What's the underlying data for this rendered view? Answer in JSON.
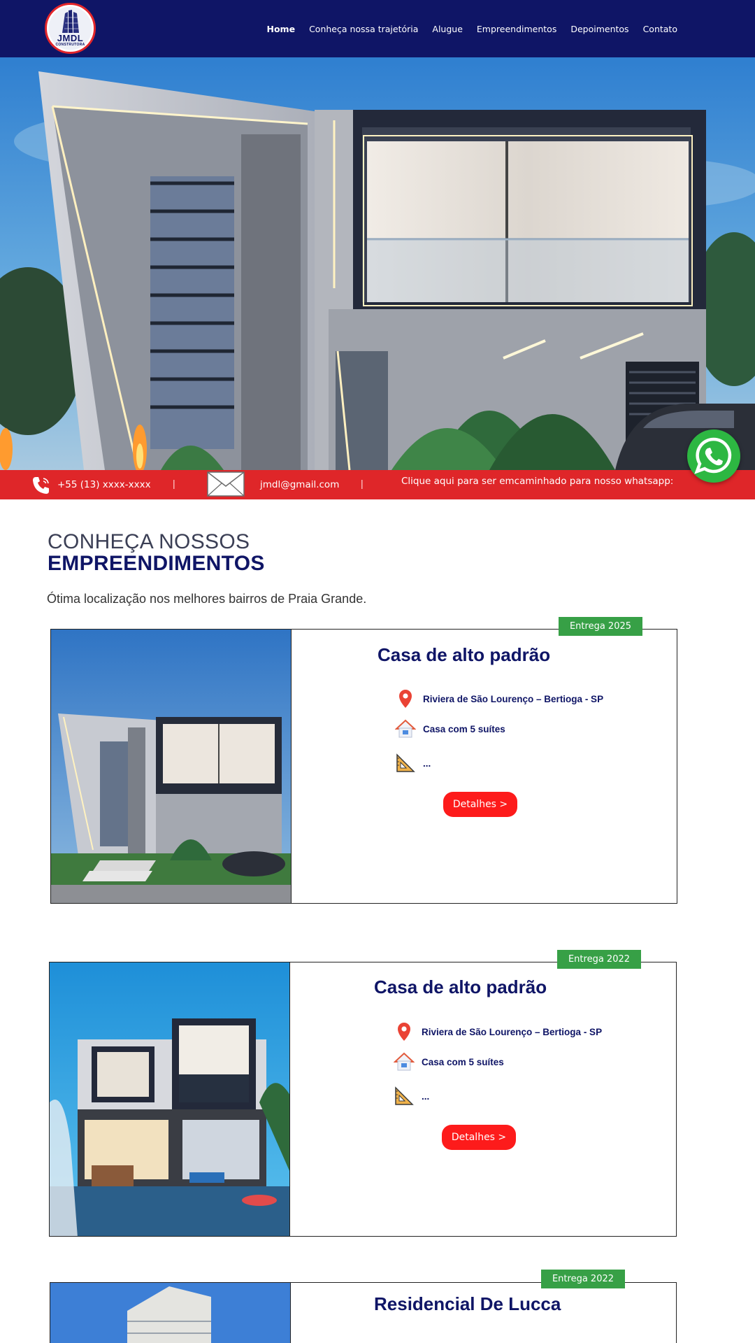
{
  "header": {
    "logo": {
      "name": "JMDL",
      "tagline": "CONSTRUTORA"
    },
    "nav": [
      {
        "label": "Home",
        "active": true
      },
      {
        "label": "Conheça nossa trajetória",
        "active": false
      },
      {
        "label": "Alugue",
        "active": false
      },
      {
        "label": "Empreendimentos",
        "active": false
      },
      {
        "label": "Depoimentos",
        "active": false
      },
      {
        "label": "Contato",
        "active": false
      }
    ],
    "bg_color": "#0f1566"
  },
  "contact_bar": {
    "phone": "+55 (13) xxxx-xxxx",
    "separator": "|",
    "email": "jmdl@gmail.com",
    "whatsapp_text": "Clique aqui para ser emcaminhado para nosso whatsapp:",
    "bg_color": "#df2629",
    "icons": [
      "phone-icon",
      "mail-icon",
      "whatsapp-icon"
    ]
  },
  "section": {
    "title_line1": "CONHEÇA NOSSOS",
    "title_line2": "EMPREENDIMENTOS",
    "subtitle": "Ótima localização nos melhores bairros de Praia Grande."
  },
  "cards": [
    {
      "badge": "Entrega 2025",
      "title": "Casa de alto padrão",
      "location": "Riviera de São Lourenço – Bertioga - SP",
      "rooms": "Casa com 5 suítes",
      "area": "...",
      "button": "Detalhes >"
    },
    {
      "badge": "Entrega 2022",
      "title": "Casa de alto padrão",
      "location": "Riviera de São Lourenço – Bertioga - SP",
      "rooms": "Casa com 5 suítes",
      "area": "...",
      "button": "Detalhes >"
    },
    {
      "badge": "Entrega 2022",
      "title": "Residencial De Lucca"
    }
  ],
  "colors": {
    "accent_red": "#fd1b1b",
    "badge_green": "#37a046",
    "navy": "#0f1566"
  }
}
